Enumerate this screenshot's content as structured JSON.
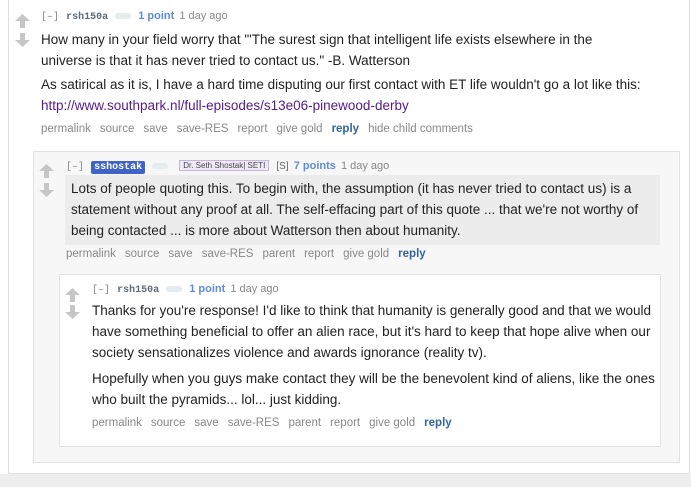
{
  "comments": [
    {
      "collapse": "[–]",
      "author": "rsh150a",
      "points": "1 point",
      "time": "1 day ago",
      "paragraphs": [
        "How many in your field worry that \"'The surest sign that intelligent life exists elsewhere in the universe is that it has never tried to contact us.\" -B. Watterson",
        "As satirical as it is, I have a hard time disputing our first contact with ET life wouldn't go a lot like this:"
      ],
      "link": "http://www.southpark.nl/full-episodes/s13e06-pinewood-derby",
      "buttons": [
        "permalink",
        "source",
        "save",
        "save-RES",
        "report",
        "give gold",
        "reply",
        "hide child comments"
      ]
    },
    {
      "collapse": "[–]",
      "author": "sshostak",
      "flair": "Dr. Seth Shostak| SETI",
      "admin": "[S]",
      "points": "7 points",
      "time": "1 day ago",
      "paragraphs": [
        "Lots of people quoting this. To begin with, the assumption (it has never tried to contact us) is a statement without any proof at all. The self-effacing part of this quote ... that we're not worthy of being contacted ... is more about Watterson then about humanity."
      ],
      "buttons": [
        "permalink",
        "source",
        "save",
        "save-RES",
        "parent",
        "report",
        "give gold",
        "reply"
      ]
    },
    {
      "collapse": "[–]",
      "author": "rsh150a",
      "points": "1 point",
      "time": "1 day ago",
      "paragraphs": [
        "Thanks for you're response! I'd like to think that humanity is generally good and that we would have something beneficial to offer an alien race, but it's hard to keep that hope alive when our society sensationalizes violence and awards ignorance (reality tv).",
        "Hopefully when you guys make contact they will be the benevolent kind of aliens, like the ones who built the pyramids... lol... just kidding."
      ],
      "buttons": [
        "permalink",
        "source",
        "save",
        "save-RES",
        "parent",
        "report",
        "give gold",
        "reply"
      ]
    }
  ],
  "icons": {
    "upvote": "upvote-arrow-icon",
    "downvote": "downvote-arrow-icon",
    "user_tag": "user-tag-chip-icon"
  },
  "colors": {
    "op_highlight": "#3f63c4",
    "points": "#5e8bd8",
    "reply": "#336699",
    "link": "#551a8b",
    "flair_bg": "#f1e9f9"
  }
}
